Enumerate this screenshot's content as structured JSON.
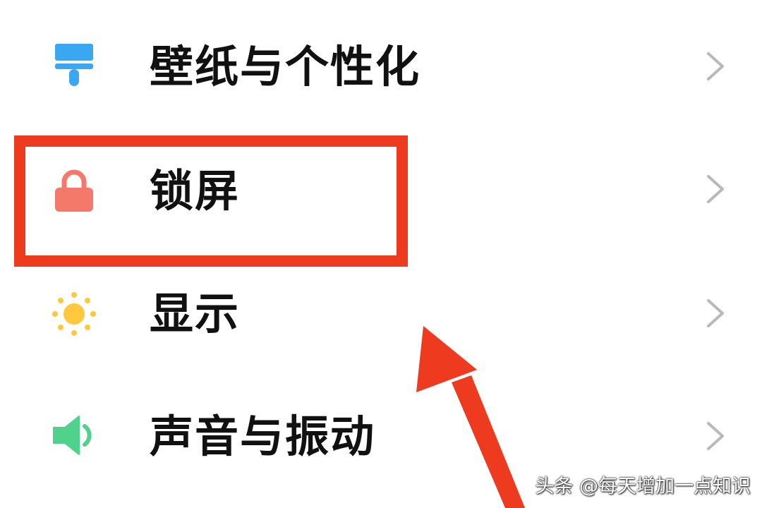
{
  "settings": {
    "items": [
      {
        "label": "壁纸与个性化",
        "icon": "wallpaper-brush-icon",
        "icon_color": "#3aa7f2"
      },
      {
        "label": "锁屏",
        "icon": "lock-icon",
        "icon_color": "#f5796a"
      },
      {
        "label": "显示",
        "icon": "sun-icon",
        "icon_color": "#ffc83d"
      },
      {
        "label": "声音与振动",
        "icon": "speaker-icon",
        "icon_color": "#4fd28c"
      }
    ],
    "chevron_icon": "chevron-right-icon"
  },
  "annotation": {
    "highlight_color": "#ee3a1f",
    "highlighted_item": "锁屏"
  },
  "watermark": {
    "text": "头条 @每天增加一点知识"
  }
}
